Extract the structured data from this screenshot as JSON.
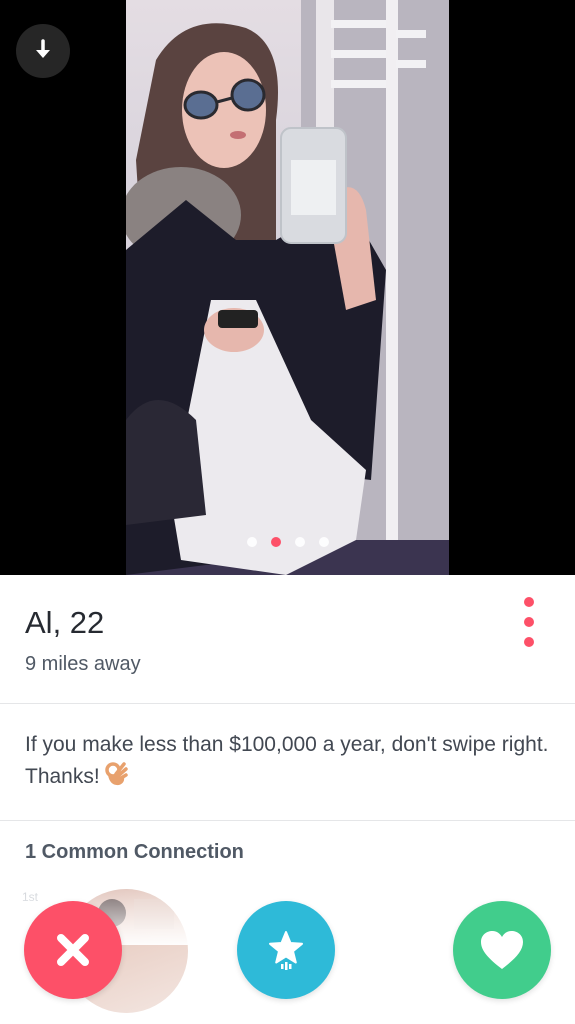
{
  "profile": {
    "name_age": "Al, 22",
    "distance": "9 miles away",
    "bio": "If you make less than $100,000 a year, don't swipe right. Thanks!",
    "bio_emoji": "ok-hand-emoji",
    "common_connections": "1 Common Connection",
    "connection_degree": "1st"
  },
  "photos": {
    "count": 4,
    "active_index": 1
  },
  "icons": {
    "download": "download-arrow-icon",
    "more": "more-options-icon",
    "nope": "nope-x-icon",
    "superlike": "super-like-star-icon",
    "like": "like-heart-icon"
  },
  "colors": {
    "accent": "#fd5068",
    "nope": "#fd5068",
    "superlike": "#2ebad8",
    "like": "#41cd8c"
  }
}
